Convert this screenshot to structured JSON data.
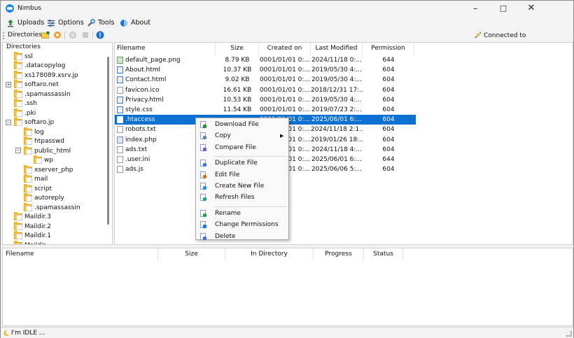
{
  "window": {
    "title": "Nimbus"
  },
  "menu": {
    "items": [
      {
        "label": "Uploads",
        "icon": "upload-icon"
      },
      {
        "label": "Options",
        "icon": "sliders-icon"
      },
      {
        "label": "Tools",
        "icon": "tools-icon"
      },
      {
        "label": "About",
        "icon": "globe-icon"
      }
    ]
  },
  "toolbar": {
    "directories_label": "Directories:",
    "status": "Connected to"
  },
  "directories": {
    "title": "Directories",
    "items": [
      {
        "label": "ssl"
      },
      {
        "label": ".datacopylog"
      },
      {
        "label": "xs178089.xsrv.jp"
      },
      {
        "label": "softaro.net",
        "expander": "+"
      },
      {
        "label": ".spamassassin"
      },
      {
        "label": ".ssh"
      },
      {
        "label": ".pki"
      },
      {
        "label": "softaro.jp",
        "expander": "−"
      },
      {
        "label": "log"
      },
      {
        "label": "htpasswd"
      },
      {
        "label": "public_html",
        "expander": "−"
      },
      {
        "label": "wp"
      },
      {
        "label": "xserver_php"
      },
      {
        "label": "mail"
      },
      {
        "label": "script"
      },
      {
        "label": "autoreply"
      },
      {
        "label": ".spamassassin"
      },
      {
        "label": "Maildir.3"
      },
      {
        "label": "Maildir.2"
      },
      {
        "label": "Maildir.1"
      },
      {
        "label": "Maildir"
      }
    ]
  },
  "files": {
    "columns": [
      "Filename",
      "Size",
      "Created on",
      "Last Modified",
      "Permission"
    ],
    "rows": [
      {
        "name": "default_page.png",
        "size": "8.79 KB",
        "created": "0001/01/01 0:...",
        "modified": "2024/11/18 0:...",
        "perm": "644",
        "icon": "image-file-icon"
      },
      {
        "name": "About.html",
        "size": "10.37 KB",
        "created": "0001/01/01 0:...",
        "modified": "2019/05/30 4:...",
        "perm": "604",
        "icon": "html-file-icon"
      },
      {
        "name": "Contact.html",
        "size": "9.02 KB",
        "created": "0001/01/01 0:...",
        "modified": "2019/05/30 4:...",
        "perm": "604",
        "icon": "html-file-icon"
      },
      {
        "name": "favicon.ico",
        "size": "16.61 KB",
        "created": "0001/01/01 0:...",
        "modified": "2018/12/31 17:...",
        "perm": "604",
        "icon": "file-icon"
      },
      {
        "name": "Privacy.html",
        "size": "10.53 KB",
        "created": "0001/01/01 0:...",
        "modified": "2019/05/30 4:...",
        "perm": "604",
        "icon": "html-file-icon"
      },
      {
        "name": "style.css",
        "size": "11.54 KB",
        "created": "0001/01/01 0:...",
        "modified": "2019/07/23 2:...",
        "perm": "604",
        "icon": "css-file-icon"
      },
      {
        "name": ".htaccess",
        "size": "",
        "created": "0001/01/01 0:...",
        "modified": "2025/06/01 6:...",
        "perm": "604",
        "icon": "file-icon",
        "selected": true
      },
      {
        "name": "robots.txt",
        "size": "",
        "created": "0001/01/01 0:...",
        "modified": "2024/11/18 2:1...",
        "perm": "604",
        "icon": "file-icon"
      },
      {
        "name": "index.php",
        "size": "",
        "created": "0001/01/01 0:...",
        "modified": "2019/01/26 18:...",
        "perm": "604",
        "icon": "php-file-icon"
      },
      {
        "name": "ads.txt",
        "size": "",
        "created": "0001/01/01 0:...",
        "modified": "2024/11/18 4:...",
        "perm": "604",
        "icon": "file-icon"
      },
      {
        "name": ".user.ini",
        "size": "",
        "created": "0001/01/01 0:...",
        "modified": "2025/06/01 6:...",
        "perm": "644",
        "icon": "file-icon"
      },
      {
        "name": "ads.js",
        "size": "",
        "created": "0001/01/01 0:...",
        "modified": "2025/06/06 5:...",
        "perm": "604",
        "icon": "js-file-icon"
      }
    ]
  },
  "context_menu": {
    "items": [
      {
        "label": "Download File",
        "icon": "download-icon"
      },
      {
        "label": "Copy",
        "icon": "copy-icon",
        "submenu": true
      },
      {
        "label": "Compare File",
        "icon": "compare-icon"
      },
      {
        "separator": true
      },
      {
        "label": "Duplicate File",
        "icon": "duplicate-icon"
      },
      {
        "label": "Edit File",
        "icon": "edit-icon"
      },
      {
        "label": "Create New File",
        "icon": "new-file-icon"
      },
      {
        "label": "Refresh Files",
        "icon": "refresh-icon"
      },
      {
        "separator": true
      },
      {
        "label": "Rename",
        "icon": "rename-icon"
      },
      {
        "label": "Change Permissions",
        "icon": "permissions-icon"
      },
      {
        "label": "Delete",
        "icon": "delete-icon"
      }
    ]
  },
  "transfers": {
    "columns": [
      "Filename",
      "Size",
      "In Directory",
      "Progress",
      "Status"
    ]
  },
  "status_bar": {
    "text": "I'm IDLE ..."
  }
}
